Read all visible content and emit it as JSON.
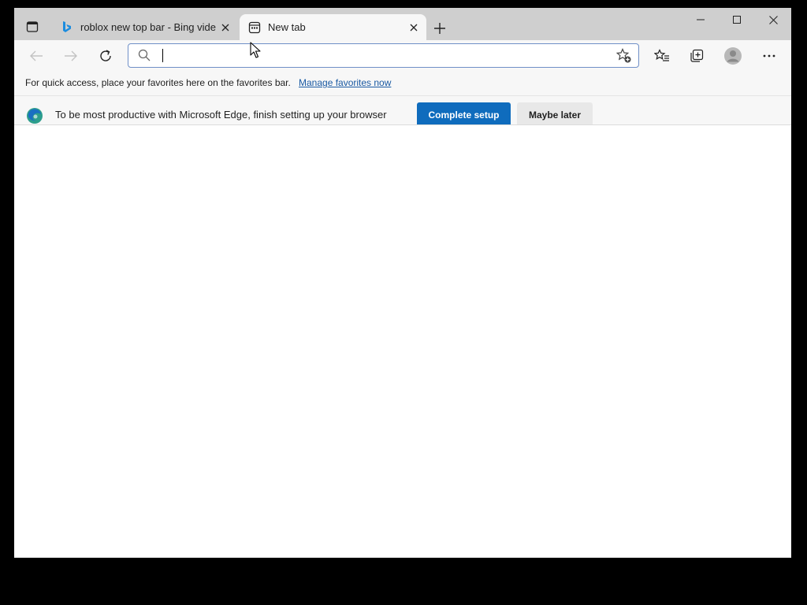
{
  "tabs": [
    {
      "title": "roblox new top bar - Bing video",
      "favicon": "bing-icon",
      "active": false
    },
    {
      "title": "New tab",
      "favicon": "new-tab-page-icon",
      "active": true
    }
  ],
  "toolbar": {
    "address_value": "",
    "icons": [
      "back-icon",
      "forward-icon",
      "refresh-icon",
      "search-icon",
      "add-favorite-icon",
      "favorites-icon",
      "collections-icon",
      "profile-icon",
      "more-icon"
    ]
  },
  "favorites_bar": {
    "message": "For quick access, place your favorites here on the favorites bar.",
    "link": "Manage favorites now"
  },
  "info_bar": {
    "message": "To be most productive with Microsoft Edge, finish setting up your browser",
    "primary_button": "Complete setup",
    "secondary_button": "Maybe later"
  },
  "colors": {
    "tab_strip": "#cfcfcf",
    "toolbar": "#f7f7f7",
    "accent": "#0f6cbd",
    "link": "#1a5aa3"
  }
}
